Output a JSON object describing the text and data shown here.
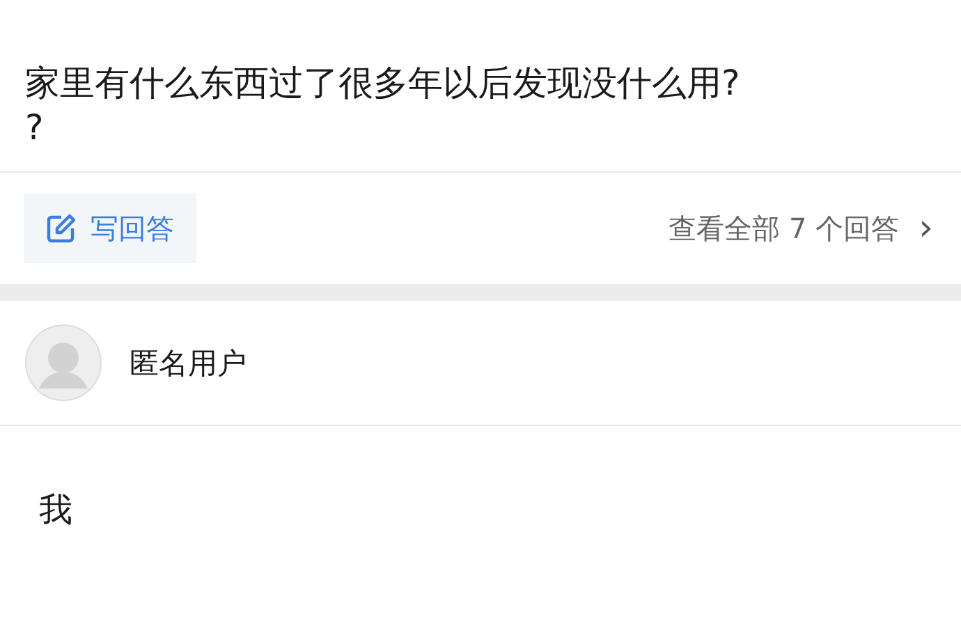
{
  "question": {
    "title_lines": [
      "家里有什么东西过了很多年以后发现没什么用?",
      "?"
    ]
  },
  "actions": {
    "write_answer": "写回答",
    "view_all": "查看全部 7 个回答",
    "chevron": "›"
  },
  "answer": {
    "author": "匿名用户",
    "content": "我"
  }
}
